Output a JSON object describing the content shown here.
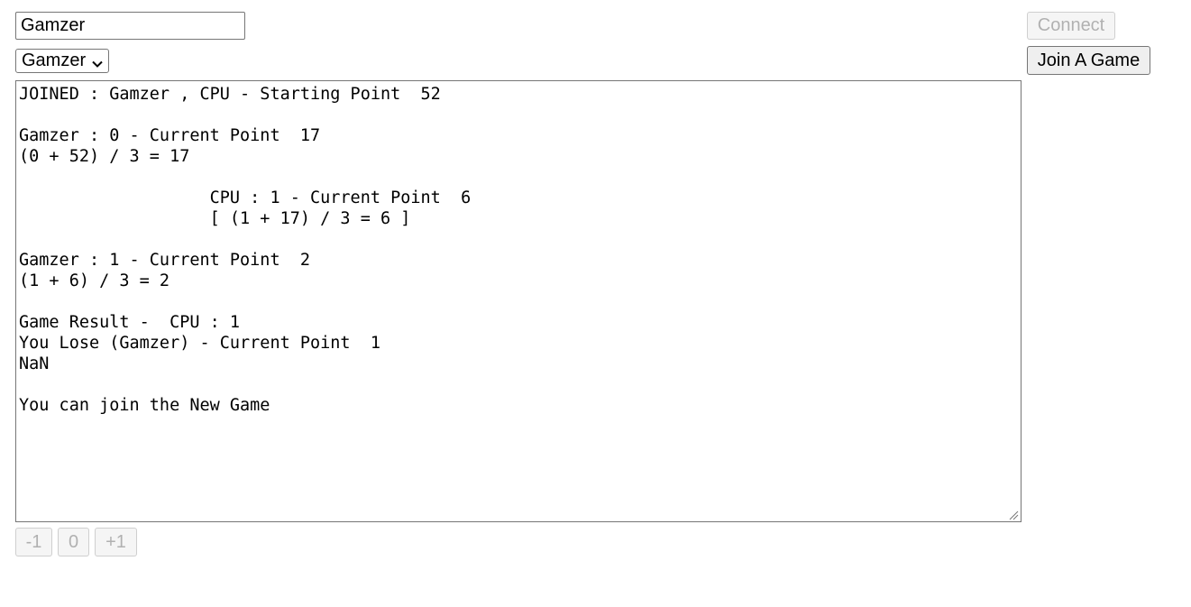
{
  "name_input": {
    "value": "Gamzer"
  },
  "player_select": {
    "selected": "Gamzer"
  },
  "buttons": {
    "connect": "Connect",
    "join": "Join A Game",
    "minus_one": "-1",
    "zero": "0",
    "plus_one": "+1"
  },
  "log": [
    "JOINED : Gamzer , CPU - Starting Point  52",
    "",
    "Gamzer : 0 - Current Point  17",
    "(0 + 52) / 3 = 17",
    "",
    "                   CPU : 1 - Current Point  6",
    "                   [ (1 + 17) / 3 = 6 ]",
    "",
    "Gamzer : 1 - Current Point  2",
    "(1 + 6) / 3 = 2",
    "",
    "Game Result -  CPU : 1",
    "You Lose (Gamzer) - Current Point  1",
    "NaN",
    "",
    "You can join the New Game"
  ],
  "icons": {
    "select_arrow": "chevron-down-icon",
    "resize": "resize-grip-icon"
  }
}
